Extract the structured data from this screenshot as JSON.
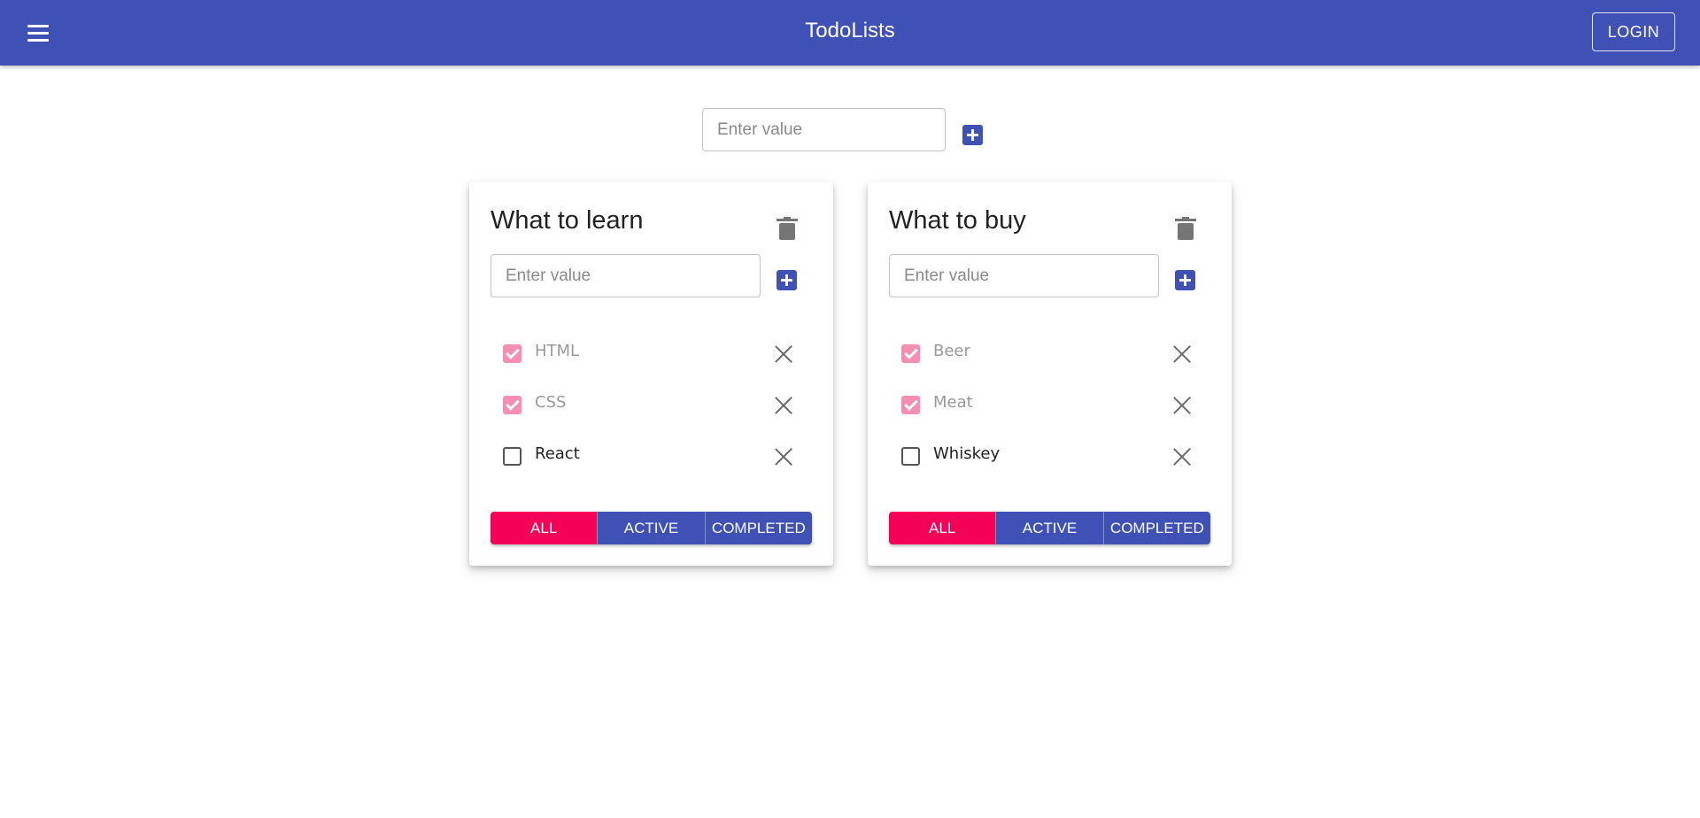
{
  "appbar": {
    "title": "TodoLists",
    "login_label": "LOGIN",
    "menu_icon": "hamburger-menu-icon",
    "color": "#3f51b5"
  },
  "add_list_form": {
    "placeholder": "Enter value",
    "value": ""
  },
  "todolists": [
    {
      "title": "What to learn",
      "input_placeholder": "Enter value",
      "tasks": [
        {
          "label": "HTML",
          "done": true
        },
        {
          "label": "CSS",
          "done": true
        },
        {
          "label": "React",
          "done": false
        }
      ],
      "filters": [
        "ALL",
        "ACTIVE",
        "COMPLETED"
      ],
      "selected_filter": "ALL"
    },
    {
      "title": "What to buy",
      "input_placeholder": "Enter value",
      "tasks": [
        {
          "label": "Beer",
          "done": true
        },
        {
          "label": "Meat",
          "done": true
        },
        {
          "label": "Whiskey",
          "done": false
        }
      ],
      "filters": [
        "ALL",
        "ACTIVE",
        "COMPLETED"
      ],
      "selected_filter": "ALL"
    }
  ],
  "colors": {
    "primary": "#3f51b5",
    "secondary": "#f50057",
    "checked": "#f48fb1"
  }
}
